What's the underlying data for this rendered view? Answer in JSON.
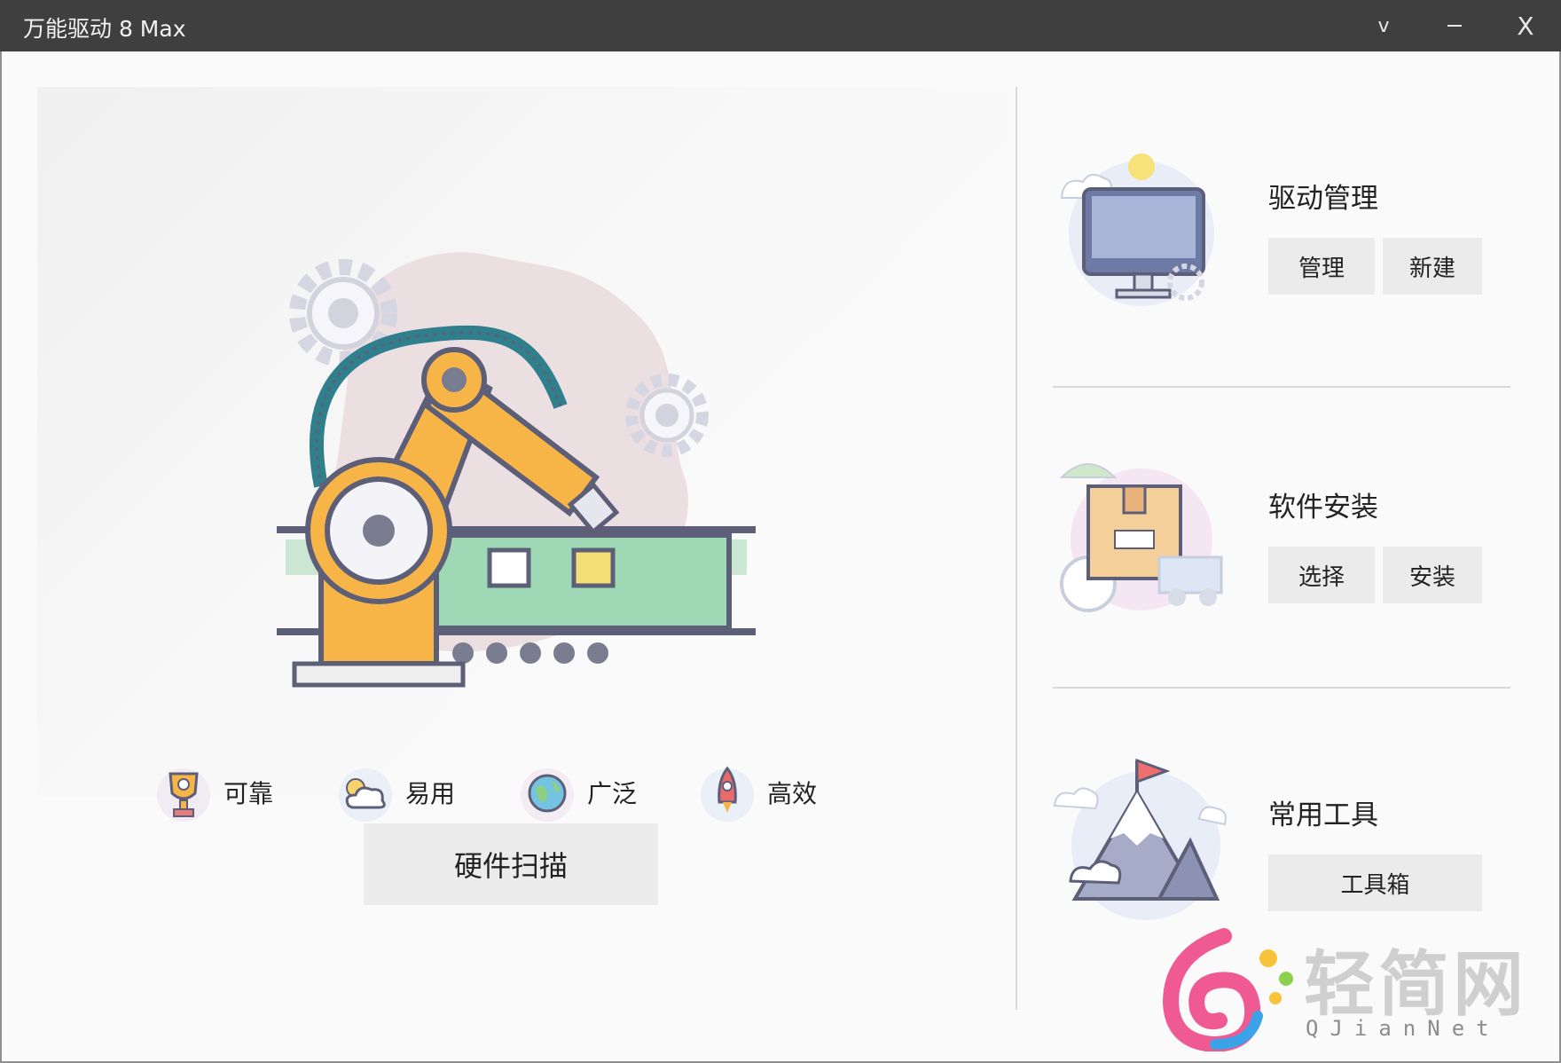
{
  "window": {
    "title": "万能驱动 8 Max",
    "controls": {
      "menu": "v",
      "minimize": "–",
      "close": "X"
    }
  },
  "features": [
    {
      "label": "可靠",
      "icon": "trophy-icon"
    },
    {
      "label": "易用",
      "icon": "cloud-icon"
    },
    {
      "label": "广泛",
      "icon": "globe-icon"
    },
    {
      "label": "高效",
      "icon": "rocket-icon"
    }
  ],
  "scan_button": "硬件扫描",
  "cards": [
    {
      "title": "驱动管理",
      "icon": "monitor-icon",
      "buttons": [
        "管理",
        "新建"
      ]
    },
    {
      "title": "软件安装",
      "icon": "package-icon",
      "buttons": [
        "选择",
        "安装"
      ]
    },
    {
      "title": "常用工具",
      "icon": "mountain-flag-icon",
      "buttons": [
        "工具箱"
      ]
    }
  ],
  "watermark": {
    "text": "轻简网",
    "sub": "QJianNet"
  },
  "colors": {
    "titlebar": "#3f3f3f",
    "background": "#fafafa",
    "button": "#ebebeb",
    "robot_orange": "#f7b548",
    "accent_teal": "#2f7f8c"
  }
}
